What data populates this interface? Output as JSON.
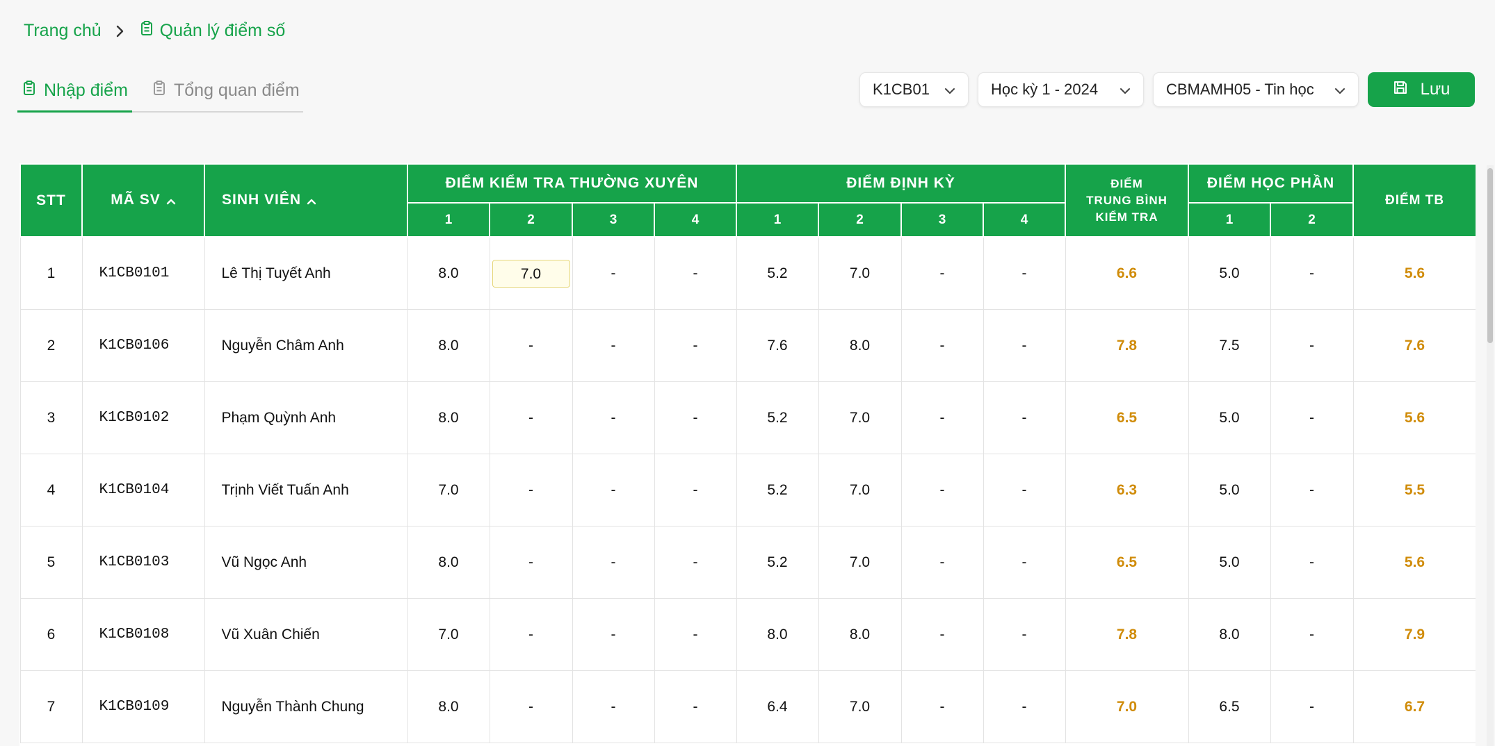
{
  "breadcrumb": {
    "home": "Trang chủ",
    "current": "Quản lý điểm số"
  },
  "tabs": [
    {
      "label": "Nhập điểm",
      "active": true
    },
    {
      "label": "Tổng quan điểm",
      "active": false
    }
  ],
  "filters": {
    "class": "K1CB01",
    "semester": "Học kỳ 1 - 2024",
    "subject": "CBMAMH05 - Tin học",
    "save_label": "Lưu"
  },
  "colors": {
    "primary": "#16a34a",
    "average": "#d08c0a",
    "editing_cell_bg": "#fffdea"
  },
  "table": {
    "headers": {
      "stt": "STT",
      "ma_sv": "MÃ SV",
      "sinh_vien": "SINH VIÊN",
      "thuong_xuyen": "ĐIỂM KIỂM TRA THƯỜNG XUYÊN",
      "dinh_ky": "ĐIỂM ĐỊNH KỲ",
      "tb_kiem_tra_1": "ĐIỂM",
      "tb_kiem_tra_2": "TRUNG BÌNH",
      "tb_kiem_tra_3": "KIỂM TRA",
      "hoc_phan": "ĐIỂM HỌC PHẦN",
      "diem_tb": "ĐIỂM TB",
      "tx_cols": [
        "1",
        "2",
        "3",
        "4"
      ],
      "dk_cols": [
        "1",
        "2",
        "3",
        "4"
      ],
      "hp_cols": [
        "1",
        "2"
      ]
    },
    "rows": [
      {
        "stt": "1",
        "id": "K1CB0101",
        "name": "Lê Thị Tuyết Anh",
        "tx": [
          "8.0",
          "7.0",
          "-",
          "-"
        ],
        "dk": [
          "5.2",
          "7.0",
          "-",
          "-"
        ],
        "tbkt": "6.6",
        "hp": [
          "5.0",
          "-"
        ],
        "tb": "5.6"
      },
      {
        "stt": "2",
        "id": "K1CB0106",
        "name": "Nguyễn Châm Anh",
        "tx": [
          "8.0",
          "-",
          "-",
          "-"
        ],
        "dk": [
          "7.6",
          "8.0",
          "-",
          "-"
        ],
        "tbkt": "7.8",
        "hp": [
          "7.5",
          "-"
        ],
        "tb": "7.6"
      },
      {
        "stt": "3",
        "id": "K1CB0102",
        "name": "Phạm Quỳnh Anh",
        "tx": [
          "8.0",
          "-",
          "-",
          "-"
        ],
        "dk": [
          "5.2",
          "7.0",
          "-",
          "-"
        ],
        "tbkt": "6.5",
        "hp": [
          "5.0",
          "-"
        ],
        "tb": "5.6"
      },
      {
        "stt": "4",
        "id": "K1CB0104",
        "name": "Trịnh Viết Tuấn Anh",
        "tx": [
          "7.0",
          "-",
          "-",
          "-"
        ],
        "dk": [
          "5.2",
          "7.0",
          "-",
          "-"
        ],
        "tbkt": "6.3",
        "hp": [
          "5.0",
          "-"
        ],
        "tb": "5.5"
      },
      {
        "stt": "5",
        "id": "K1CB0103",
        "name": "Vũ Ngọc Anh",
        "tx": [
          "8.0",
          "-",
          "-",
          "-"
        ],
        "dk": [
          "5.2",
          "7.0",
          "-",
          "-"
        ],
        "tbkt": "6.5",
        "hp": [
          "5.0",
          "-"
        ],
        "tb": "5.6"
      },
      {
        "stt": "6",
        "id": "K1CB0108",
        "name": "Vũ Xuân Chiến",
        "tx": [
          "7.0",
          "-",
          "-",
          "-"
        ],
        "dk": [
          "8.0",
          "8.0",
          "-",
          "-"
        ],
        "tbkt": "7.8",
        "hp": [
          "8.0",
          "-"
        ],
        "tb": "7.9"
      },
      {
        "stt": "7",
        "id": "K1CB0109",
        "name": "Nguyễn Thành Chung",
        "tx": [
          "8.0",
          "-",
          "-",
          "-"
        ],
        "dk": [
          "6.4",
          "7.0",
          "-",
          "-"
        ],
        "tbkt": "7.0",
        "hp": [
          "6.5",
          "-"
        ],
        "tb": "6.7"
      }
    ]
  }
}
